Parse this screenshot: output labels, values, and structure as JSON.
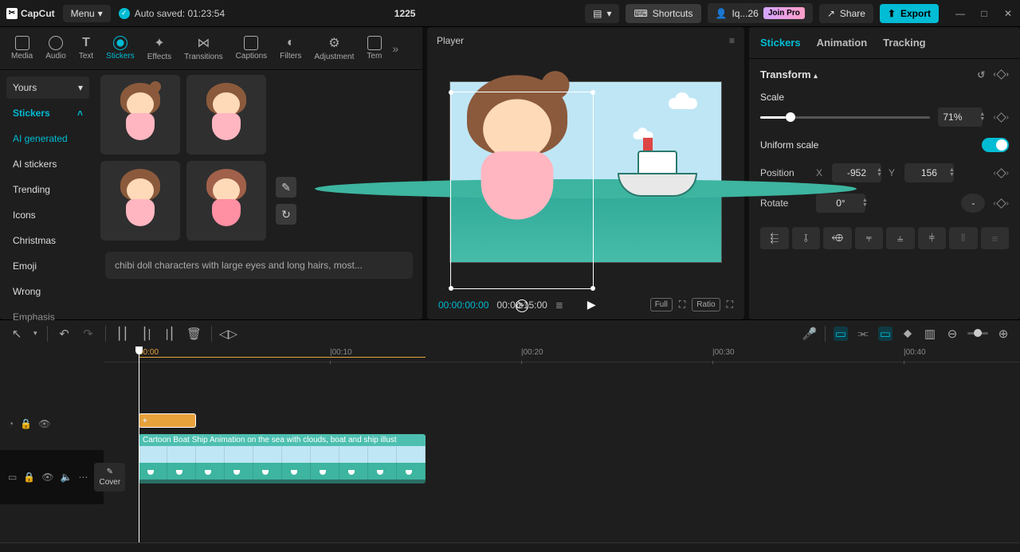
{
  "app": {
    "name": "CapCut",
    "menu_label": "Menu",
    "autosave": "Auto saved: 01:23:54",
    "project_name": "1225"
  },
  "titlebar": {
    "shortcuts": "Shortcuts",
    "user": "Iq...26",
    "join_pro": "Join Pro",
    "share": "Share",
    "export": "Export"
  },
  "tool_tabs": {
    "media": "Media",
    "audio": "Audio",
    "text": "Text",
    "stickers": "Stickers",
    "effects": "Effects",
    "transitions": "Transitions",
    "captions": "Captions",
    "filters": "Filters",
    "adjustment": "Adjustment",
    "templates": "Tem"
  },
  "sidebar": {
    "yours": "Yours",
    "stickers": "Stickers",
    "items": [
      "AI generated",
      "AI stickers",
      "Trending",
      "Icons",
      "Christmas",
      "Emoji",
      "Wrong",
      "Emphasis"
    ]
  },
  "sticker_prompt": "chibi doll characters with large eyes and long hairs, most...",
  "player": {
    "title": "Player",
    "time_current": "00:00:00:00",
    "time_total": "00:00:15:00",
    "full": "Full",
    "ratio": "Ratio"
  },
  "inspector": {
    "tabs": {
      "stickers": "Stickers",
      "animation": "Animation",
      "tracking": "Tracking"
    },
    "transform": "Transform",
    "scale": {
      "label": "Scale",
      "value": "71%",
      "pct": 15
    },
    "uniform_scale": "Uniform scale",
    "position": {
      "label": "Position",
      "x_label": "X",
      "x": "-952",
      "y_label": "Y",
      "y": "156"
    },
    "rotate": {
      "label": "Rotate",
      "value": "0°",
      "flip": "-"
    }
  },
  "timeline": {
    "marks": [
      "00:00",
      "|00:10",
      "|00:20",
      "|00:30",
      "|00:40"
    ],
    "cover": "Cover",
    "video_clip_title": "Cartoon Boat Ship Animation on the sea with clouds, boat and ship illust"
  }
}
